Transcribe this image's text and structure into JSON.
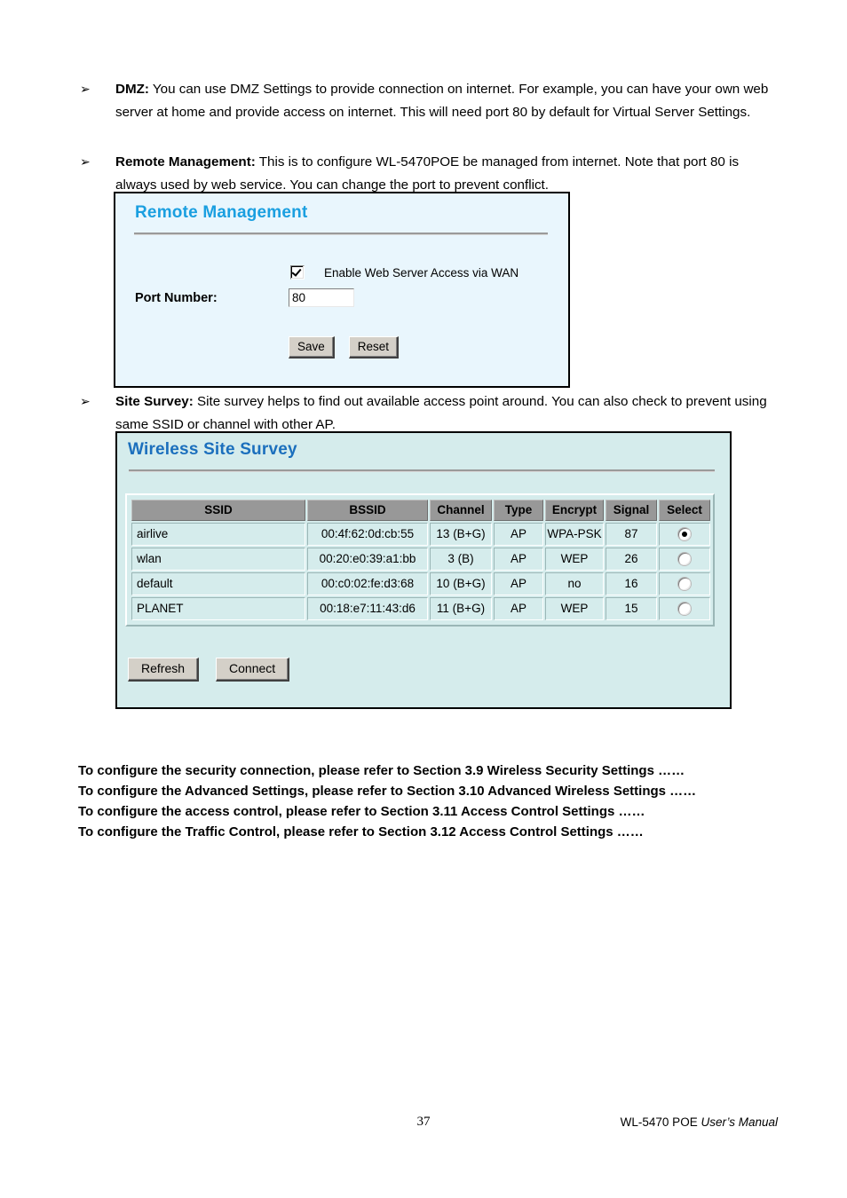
{
  "bullets": [
    {
      "marker": "➢",
      "term": "DMZ:",
      "body": " You can use DMZ Settings to provide connection on internet. For example, you can have your own web server at home and provide access on internet. This will need port 80 by default for Virtual Server Settings."
    },
    {
      "marker": "➢",
      "term": "Remote Management:",
      "body": " This is to configure WL-5470POE be managed from internet. Note that port 80 is always used by web service. You can change the port to prevent conflict."
    },
    {
      "marker": "➢",
      "term": "Site Survey:",
      "body": " Site survey helps to find out available access point around. You can also check to prevent using same SSID or channel with other AP."
    }
  ],
  "remote_management": {
    "title": "Remote Management",
    "enable_checkbox": {
      "label": "Enable Web Server Access via WAN",
      "checked": true
    },
    "port_label": "Port Number:",
    "port_value": "80",
    "save_label": "Save",
    "reset_label": "Reset",
    "title_color": "#1a9fe0",
    "panel_bg": "#e9f6fd"
  },
  "site_survey": {
    "title": "Wireless Site Survey",
    "title_color": "#1b6fbd",
    "panel_bg": "#d5ecec",
    "header_bg": "#989898",
    "columns": [
      "SSID",
      "BSSID",
      "Channel",
      "Type",
      "Encrypt",
      "Signal",
      "Select"
    ],
    "rows": [
      {
        "ssid": "airlive",
        "bssid": "00:4f:62:0d:cb:55",
        "channel": "13 (B+G)",
        "type": "AP",
        "encrypt": "WPA-PSK",
        "signal": "87",
        "selected": true
      },
      {
        "ssid": "wlan",
        "bssid": "00:20:e0:39:a1:bb",
        "channel": "3 (B)",
        "type": "AP",
        "encrypt": "WEP",
        "signal": "26",
        "selected": false
      },
      {
        "ssid": "default",
        "bssid": "00:c0:02:fe:d3:68",
        "channel": "10 (B+G)",
        "type": "AP",
        "encrypt": "no",
        "signal": "16",
        "selected": false
      },
      {
        "ssid": "PLANET",
        "bssid": "00:18:e7:11:43:d6",
        "channel": "11 (B+G)",
        "type": "AP",
        "encrypt": "WEP",
        "signal": "15",
        "selected": false
      }
    ],
    "refresh_label": "Refresh",
    "connect_label": "Connect"
  },
  "reference_lines": [
    "To configure the security connection, please refer to Section 3.9 Wireless Security Settings ……",
    "To configure the Advanced Settings, please refer to Section 3.10 Advanced Wireless Settings ……",
    "To configure the access control, please refer to Section 3.11 Access Control Settings ……",
    "To configure the Traffic Control, please refer to Section 3.12 Access Control Settings ……"
  ],
  "footer": {
    "page_number": "37",
    "manual_plain": "WL-5470 POE ",
    "manual_italic": "User’s Manual"
  }
}
